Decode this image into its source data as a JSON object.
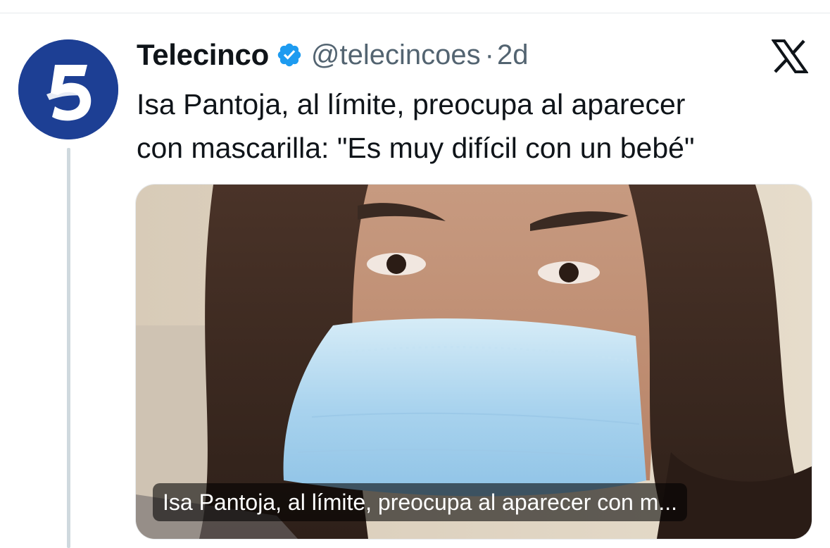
{
  "tweet": {
    "display_name": "Telecinco",
    "handle": "@telecincoes",
    "separator": "·",
    "time": "2d",
    "text_lines": [
      "Isa Pantoja, al límite, preocupa al aparecer",
      "con mascarilla: \"Es muy difícil con un bebé\""
    ]
  },
  "avatar": {
    "logo_text": "5",
    "icon": "telecinco-logo"
  },
  "card": {
    "caption": "Isa Pantoja, al límite, preocupa al aparecer con m...",
    "image_subject": "woman-with-face-mask-photo"
  },
  "colors": {
    "avatar_bg": "#1d3f94",
    "verified_badge": "#1d9bf0",
    "secondary_text": "#536471",
    "primary_text": "#0f1419",
    "thread_line": "#cfd9de"
  },
  "icons": [
    "verified-badge-icon",
    "x-logo-icon"
  ]
}
